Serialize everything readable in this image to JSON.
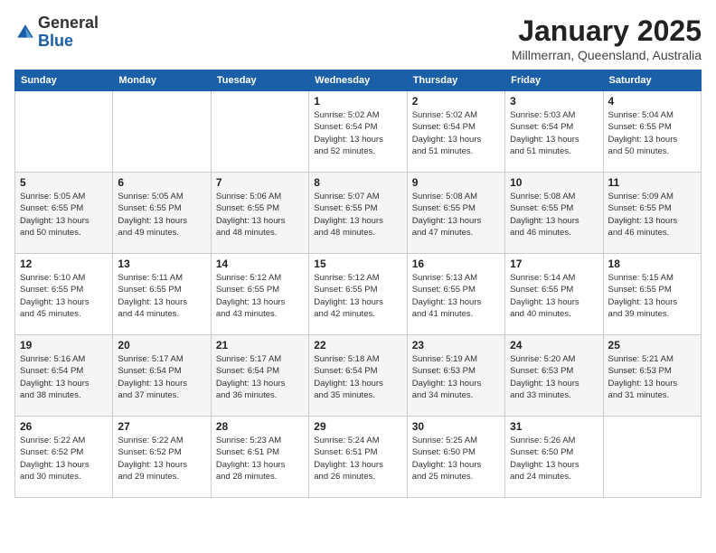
{
  "logo": {
    "general": "General",
    "blue": "Blue"
  },
  "header": {
    "month": "January 2025",
    "location": "Millmerran, Queensland, Australia"
  },
  "days_of_week": [
    "Sunday",
    "Monday",
    "Tuesday",
    "Wednesday",
    "Thursday",
    "Friday",
    "Saturday"
  ],
  "weeks": [
    [
      {
        "day": "",
        "info": ""
      },
      {
        "day": "",
        "info": ""
      },
      {
        "day": "",
        "info": ""
      },
      {
        "day": "1",
        "info": "Sunrise: 5:02 AM\nSunset: 6:54 PM\nDaylight: 13 hours\nand 52 minutes."
      },
      {
        "day": "2",
        "info": "Sunrise: 5:02 AM\nSunset: 6:54 PM\nDaylight: 13 hours\nand 51 minutes."
      },
      {
        "day": "3",
        "info": "Sunrise: 5:03 AM\nSunset: 6:54 PM\nDaylight: 13 hours\nand 51 minutes."
      },
      {
        "day": "4",
        "info": "Sunrise: 5:04 AM\nSunset: 6:55 PM\nDaylight: 13 hours\nand 50 minutes."
      }
    ],
    [
      {
        "day": "5",
        "info": "Sunrise: 5:05 AM\nSunset: 6:55 PM\nDaylight: 13 hours\nand 50 minutes."
      },
      {
        "day": "6",
        "info": "Sunrise: 5:05 AM\nSunset: 6:55 PM\nDaylight: 13 hours\nand 49 minutes."
      },
      {
        "day": "7",
        "info": "Sunrise: 5:06 AM\nSunset: 6:55 PM\nDaylight: 13 hours\nand 48 minutes."
      },
      {
        "day": "8",
        "info": "Sunrise: 5:07 AM\nSunset: 6:55 PM\nDaylight: 13 hours\nand 48 minutes."
      },
      {
        "day": "9",
        "info": "Sunrise: 5:08 AM\nSunset: 6:55 PM\nDaylight: 13 hours\nand 47 minutes."
      },
      {
        "day": "10",
        "info": "Sunrise: 5:08 AM\nSunset: 6:55 PM\nDaylight: 13 hours\nand 46 minutes."
      },
      {
        "day": "11",
        "info": "Sunrise: 5:09 AM\nSunset: 6:55 PM\nDaylight: 13 hours\nand 46 minutes."
      }
    ],
    [
      {
        "day": "12",
        "info": "Sunrise: 5:10 AM\nSunset: 6:55 PM\nDaylight: 13 hours\nand 45 minutes."
      },
      {
        "day": "13",
        "info": "Sunrise: 5:11 AM\nSunset: 6:55 PM\nDaylight: 13 hours\nand 44 minutes."
      },
      {
        "day": "14",
        "info": "Sunrise: 5:12 AM\nSunset: 6:55 PM\nDaylight: 13 hours\nand 43 minutes."
      },
      {
        "day": "15",
        "info": "Sunrise: 5:12 AM\nSunset: 6:55 PM\nDaylight: 13 hours\nand 42 minutes."
      },
      {
        "day": "16",
        "info": "Sunrise: 5:13 AM\nSunset: 6:55 PM\nDaylight: 13 hours\nand 41 minutes."
      },
      {
        "day": "17",
        "info": "Sunrise: 5:14 AM\nSunset: 6:55 PM\nDaylight: 13 hours\nand 40 minutes."
      },
      {
        "day": "18",
        "info": "Sunrise: 5:15 AM\nSunset: 6:55 PM\nDaylight: 13 hours\nand 39 minutes."
      }
    ],
    [
      {
        "day": "19",
        "info": "Sunrise: 5:16 AM\nSunset: 6:54 PM\nDaylight: 13 hours\nand 38 minutes."
      },
      {
        "day": "20",
        "info": "Sunrise: 5:17 AM\nSunset: 6:54 PM\nDaylight: 13 hours\nand 37 minutes."
      },
      {
        "day": "21",
        "info": "Sunrise: 5:17 AM\nSunset: 6:54 PM\nDaylight: 13 hours\nand 36 minutes."
      },
      {
        "day": "22",
        "info": "Sunrise: 5:18 AM\nSunset: 6:54 PM\nDaylight: 13 hours\nand 35 minutes."
      },
      {
        "day": "23",
        "info": "Sunrise: 5:19 AM\nSunset: 6:53 PM\nDaylight: 13 hours\nand 34 minutes."
      },
      {
        "day": "24",
        "info": "Sunrise: 5:20 AM\nSunset: 6:53 PM\nDaylight: 13 hours\nand 33 minutes."
      },
      {
        "day": "25",
        "info": "Sunrise: 5:21 AM\nSunset: 6:53 PM\nDaylight: 13 hours\nand 31 minutes."
      }
    ],
    [
      {
        "day": "26",
        "info": "Sunrise: 5:22 AM\nSunset: 6:52 PM\nDaylight: 13 hours\nand 30 minutes."
      },
      {
        "day": "27",
        "info": "Sunrise: 5:22 AM\nSunset: 6:52 PM\nDaylight: 13 hours\nand 29 minutes."
      },
      {
        "day": "28",
        "info": "Sunrise: 5:23 AM\nSunset: 6:51 PM\nDaylight: 13 hours\nand 28 minutes."
      },
      {
        "day": "29",
        "info": "Sunrise: 5:24 AM\nSunset: 6:51 PM\nDaylight: 13 hours\nand 26 minutes."
      },
      {
        "day": "30",
        "info": "Sunrise: 5:25 AM\nSunset: 6:50 PM\nDaylight: 13 hours\nand 25 minutes."
      },
      {
        "day": "31",
        "info": "Sunrise: 5:26 AM\nSunset: 6:50 PM\nDaylight: 13 hours\nand 24 minutes."
      },
      {
        "day": "",
        "info": ""
      }
    ]
  ]
}
